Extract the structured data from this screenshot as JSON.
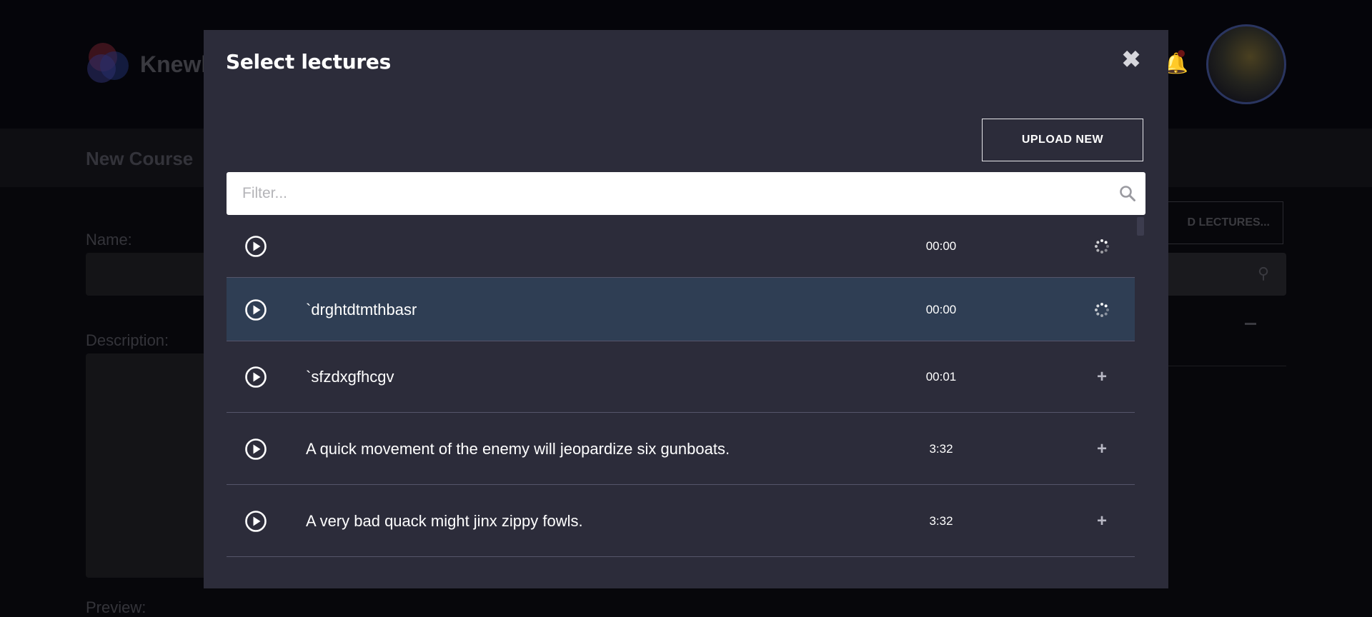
{
  "background": {
    "brand": "Knewl",
    "page_heading": "New Course",
    "name_label": "Name:",
    "description_label": "Description:",
    "preview_label": "Preview:",
    "lectures_button": "D LECTURES..."
  },
  "modal": {
    "title": "Select lectures",
    "close_icon": "close-icon",
    "upload_label": "UPLOAD NEW",
    "search": {
      "placeholder": "Filter...",
      "value": "",
      "icon": "search-icon"
    },
    "lectures": [
      {
        "title": "",
        "duration": "00:00",
        "action": "loading-spinner-icon",
        "highlighted": false
      },
      {
        "title": "`drghtdtmthbasr",
        "duration": "00:00",
        "action": "loading-spinner-icon",
        "highlighted": true
      },
      {
        "title": "`sfzdxgfhcgv",
        "duration": "00:01",
        "action": "plus-icon",
        "highlighted": false
      },
      {
        "title": "A quick movement of the enemy will jeopardize six gunboats.",
        "duration": "3:32",
        "action": "plus-icon",
        "highlighted": false
      },
      {
        "title": "A very bad quack might jinx zippy fowls.",
        "duration": "3:32",
        "action": "plus-icon",
        "highlighted": false
      }
    ]
  },
  "colors": {
    "modal_bg": "#2c2c3a",
    "row_highlight": "#2f3e54",
    "row_divider": "#55556a",
    "overlay": "#07070b"
  }
}
